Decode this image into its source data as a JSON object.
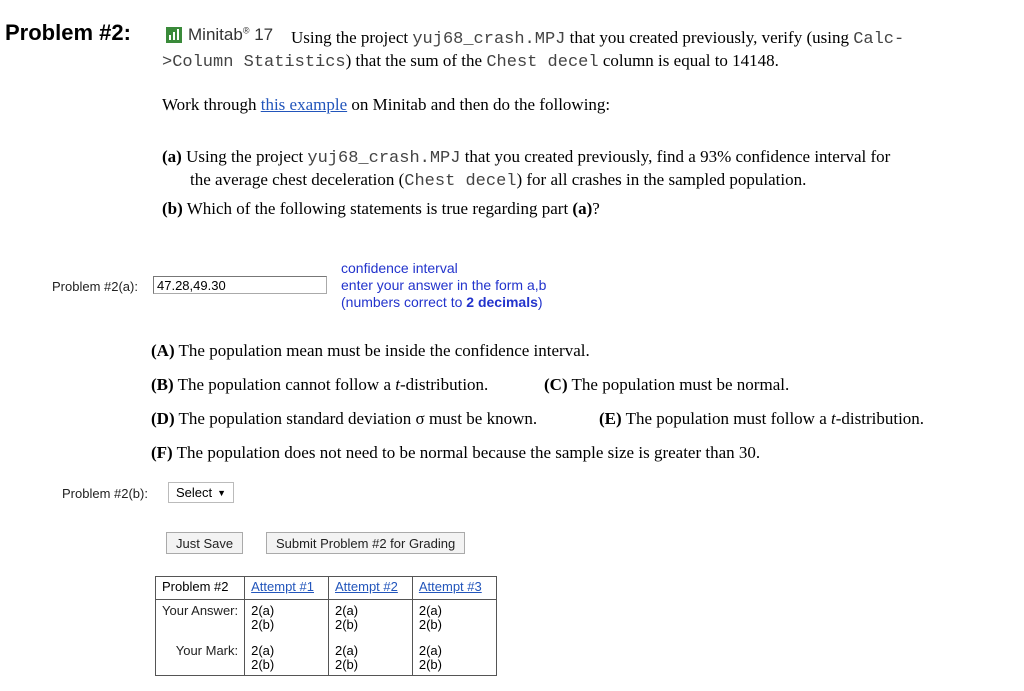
{
  "problem": {
    "title": "Problem #2:",
    "logo_text": "Minitab",
    "logo_version": "17",
    "intro_l1_a": "Using the project ",
    "intro_project": "yuj68_crash.MPJ",
    "intro_l1_b": " that you created previously, verify (using ",
    "intro_calc": "Calc-",
    "intro_l2_code": ">Column Statistics",
    "intro_l2_a": ") that the sum of the ",
    "intro_col": "Chest decel",
    "intro_l2_b": " column is equal to 14148.",
    "work_a": "Work through ",
    "work_link": "this example",
    "work_b": " on Minitab and then do the following:",
    "part_a_label": "(a)",
    "part_a_l1_a": " Using the project ",
    "part_a_project": "yuj68_crash.MPJ",
    "part_a_l1_b": " that you created previously, find a 93% confidence interval for",
    "part_a_l2_a": "the average chest deceleration (",
    "part_a_col": "Chest decel",
    "part_a_l2_b": ") for all crashes in the sampled population.",
    "part_b_label": "(b)",
    "part_b_text_a": " Which of the following statements is true regarding part ",
    "part_b_ref": "(a)",
    "part_b_text_b": "?"
  },
  "answer_a": {
    "label": "Problem #2(a):",
    "value": "47.28,49.30",
    "hint_l1": "confidence interval",
    "hint_l2": "enter your answer in the form a,b",
    "hint_l3_a": "(numbers correct to ",
    "hint_l3_b": "2 decimals",
    "hint_l3_c": ")"
  },
  "options": [
    {
      "label": "(A)",
      "text": " The population mean must be inside the confidence interval."
    },
    {
      "label": "(B)",
      "text_a": " The population cannot follow a ",
      "t": "t",
      "text_b": "-distribution."
    },
    {
      "label": "(C)",
      "text": " The population must be normal."
    },
    {
      "label": "(D)",
      "text": " The population standard deviation σ must be known."
    },
    {
      "label": "(E)",
      "text_a": " The population must follow a ",
      "t": "t",
      "text_b": "-distribution."
    },
    {
      "label": "(F)",
      "text": " The population does not need to be normal because the sample size is greater than 30."
    }
  ],
  "answer_b": {
    "label": "Problem #2(b):",
    "select_label": "Select",
    "select_arrow": "▼"
  },
  "buttons": {
    "save": "Just Save",
    "submit": "Submit Problem #2 for Grading"
  },
  "table": {
    "header": "Problem #2",
    "attempts": [
      "Attempt #1",
      "Attempt #2",
      "Attempt #3"
    ],
    "row1_label": "Your Answer:",
    "row2_label": "Your Mark:",
    "cell_a": "2(a)",
    "cell_b": "2(b)"
  }
}
